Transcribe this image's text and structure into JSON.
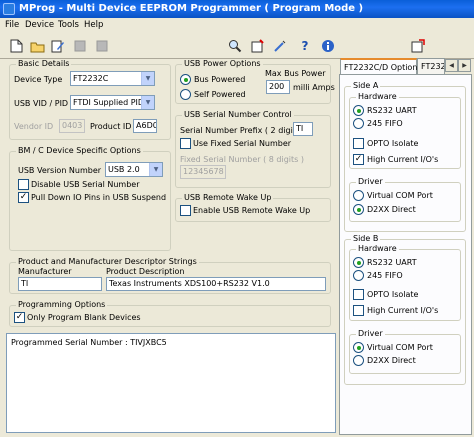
{
  "window": {
    "title": "MProg - Multi Device EEPROM Programmer ( Program Mode )"
  },
  "menu": [
    "File",
    "Device",
    "Tools",
    "Help"
  ],
  "toolbar": {
    "icons": [
      "new-file-icon",
      "open-folder-icon",
      "edit-icon",
      "disabled-icon",
      "disabled-icon",
      "search-icon",
      "program-icon",
      "wand-icon",
      "help-icon",
      "info-icon",
      "exit-icon"
    ]
  },
  "basic": {
    "title": "Basic Details",
    "device_type_label": "Device Type",
    "device_type": "FT2232C",
    "vidpid_label": "USB VID / PID",
    "vidpid": "FTDI Supplied PID",
    "vendor_label": "Vendor ID",
    "vendor_value": "0403",
    "product_label": "Product ID",
    "product_value": "A6D0"
  },
  "power": {
    "title": "USB Power Options",
    "bus_label": "Bus Powered",
    "self_label": "Self Powered",
    "max_label": "Max Bus Power",
    "max_value": "200",
    "units": "milli Amps"
  },
  "bm": {
    "title": "BM / C Device Specific Options",
    "version_label": "USB Version Number",
    "version": "USB 2.0",
    "disable_serial": "Disable USB Serial Number",
    "pulldown": "Pull Down IO Pins in USB Suspend"
  },
  "serial": {
    "title": "USB Serial Number Control",
    "prefix_label": "Serial Number Prefix ( 2 digits )",
    "prefix_value": "TI",
    "use_fixed": "Use Fixed Serial Number",
    "fixed_label": "Fixed Serial Number ( 8 digits )",
    "fixed_value": "12345678"
  },
  "wake": {
    "title": "USB Remote Wake Up",
    "enable": "Enable USB Remote Wake Up"
  },
  "strings": {
    "title": "Product and Manufacturer Descriptor Strings",
    "manufacturer_label": "Manufacturer",
    "manufacturer": "TI",
    "product_desc_label": "Product Description",
    "product_desc": "Texas Instruments XDS100+RS232 V1.0"
  },
  "program": {
    "title": "Programming Options",
    "only_blank": "Only Program Blank Devices"
  },
  "log": {
    "text": "Programmed Serial Number : TIVJXBC5"
  },
  "tabs": [
    "FT2232C/D Options",
    "FT232"
  ],
  "sideA": {
    "title": "Side A",
    "hw_title": "Hardware",
    "uart": "RS232 UART",
    "fifo": "245 FIFO",
    "opto": "OPTO Isolate",
    "high_current": "High Current I/O's",
    "drv_title": "Driver",
    "vcp": "Virtual COM Port",
    "d2xx": "D2XX Direct"
  },
  "sideB": {
    "title": "Side B",
    "hw_title": "Hardware",
    "uart": "RS232 UART",
    "fifo": "245 FIFO",
    "opto": "OPTO Isolate",
    "high_current": "High Current I/O's",
    "drv_title": "Driver",
    "vcp": "Virtual COM Port",
    "d2xx": "D2XX Direct"
  }
}
